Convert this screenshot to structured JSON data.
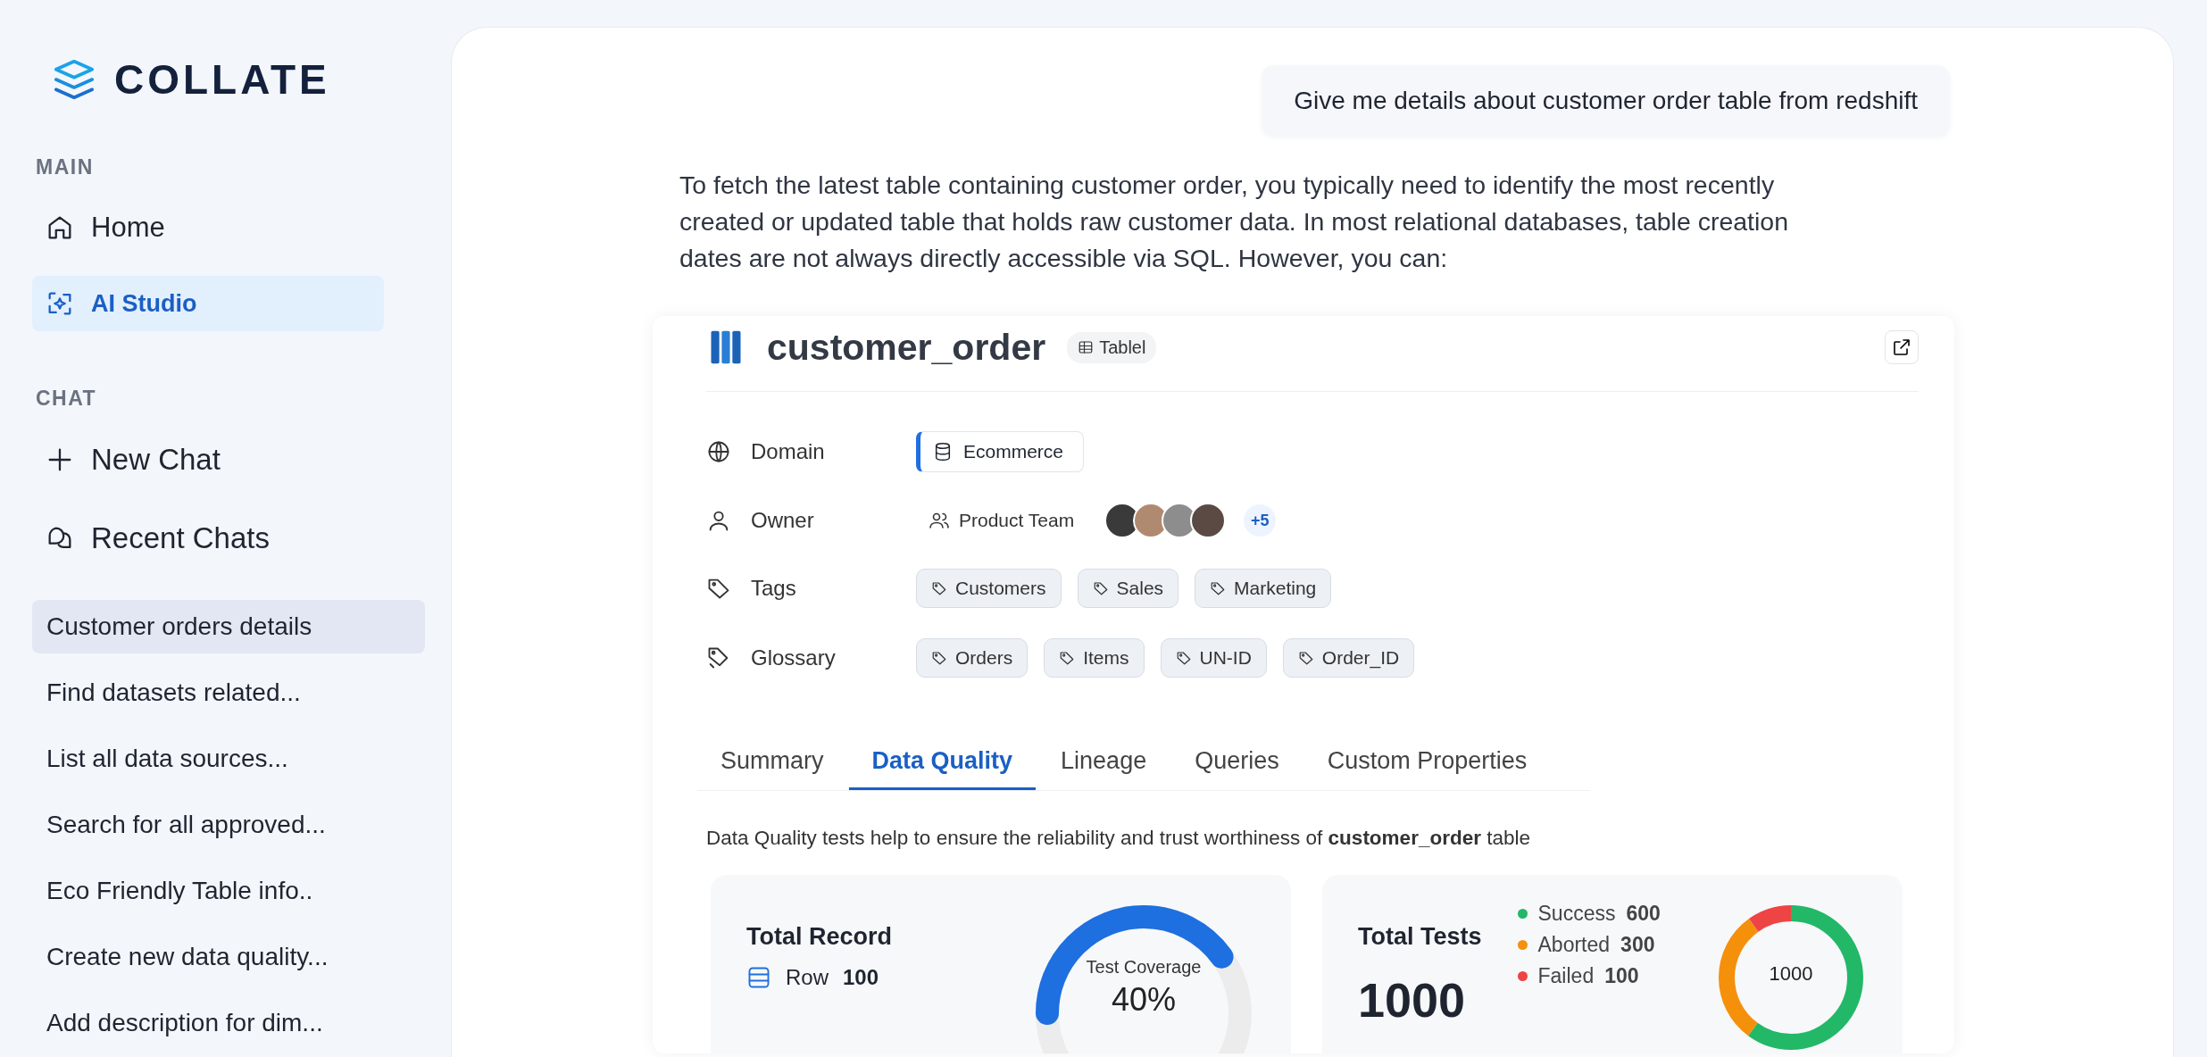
{
  "sidebar": {
    "logo": "COLLATE",
    "sections": [
      {
        "heading": "MAIN",
        "items": [
          {
            "label": "Home",
            "kind": "home",
            "selected": false
          },
          {
            "label": "AI Studio",
            "kind": "ai",
            "selected": true
          }
        ]
      },
      {
        "heading": "CHAT",
        "items": [
          {
            "label": "New Chat",
            "kind": "plus",
            "selected": false
          },
          {
            "label": "Recent Chats",
            "kind": "chats",
            "selected": false
          }
        ]
      }
    ],
    "recent_chats": [
      {
        "label": "Customer orders details",
        "selected": true
      },
      {
        "label": "Find datasets related...",
        "selected": false
      },
      {
        "label": "List all data sources...",
        "selected": false
      },
      {
        "label": "Search for all approved...",
        "selected": false
      },
      {
        "label": "Eco Friendly Table info..",
        "selected": false
      },
      {
        "label": "Create new data quality...",
        "selected": false
      },
      {
        "label": "Add description for dim...",
        "selected": false
      }
    ]
  },
  "chat": {
    "user_message": "Give me details about customer order table from redshift",
    "reply": "To fetch the latest table containing customer order, you typically need to identify the most recently created or updated table that holds raw customer data. In most relational databases, table creation dates are not always directly accessible via SQL. However, you can:",
    "card": {
      "title": "customer_order",
      "type_badge": "Tablel",
      "properties": [
        {
          "label": "Domain",
          "kind": "domain",
          "values": [
            "Ecommerce"
          ]
        },
        {
          "label": "Owner",
          "kind": "owner",
          "values": [
            "Product Team"
          ],
          "more": "+5"
        },
        {
          "label": "Tags",
          "kind": "tags",
          "values": [
            "Customers",
            "Sales",
            "Marketing"
          ]
        },
        {
          "label": "Glossary",
          "kind": "glossary",
          "values": [
            "Orders",
            "Items",
            "UN-ID",
            "Order_ID"
          ]
        }
      ],
      "tabs": [
        {
          "label": "Summary",
          "selected": false
        },
        {
          "label": "Data Quality",
          "selected": true
        },
        {
          "label": "Lineage",
          "selected": false
        },
        {
          "label": "Queries",
          "selected": false
        },
        {
          "label": "Custom Properties",
          "selected": false
        }
      ],
      "description": "Data Quality tests help to ensure the reliability and trust worthiness of **customer_order** table",
      "total_record": {
        "title": "Total Record",
        "rows": [
          {
            "label": "Row",
            "value": "100"
          }
        ],
        "coverage": {
          "label": "Test Coverage",
          "reading": "40%",
          "level": 0.4
        }
      },
      "total_tests": {
        "title": "Total Tests",
        "total": "1000",
        "center": "1000",
        "legend": [
          {
            "label": "Success",
            "value": "600",
            "color": "#22b868"
          },
          {
            "label": "Aborted",
            "value": "300",
            "color": "#f5900b"
          },
          {
            "label": "Failed",
            "value": "100",
            "color": "#ef4444"
          }
        ]
      }
    }
  }
}
